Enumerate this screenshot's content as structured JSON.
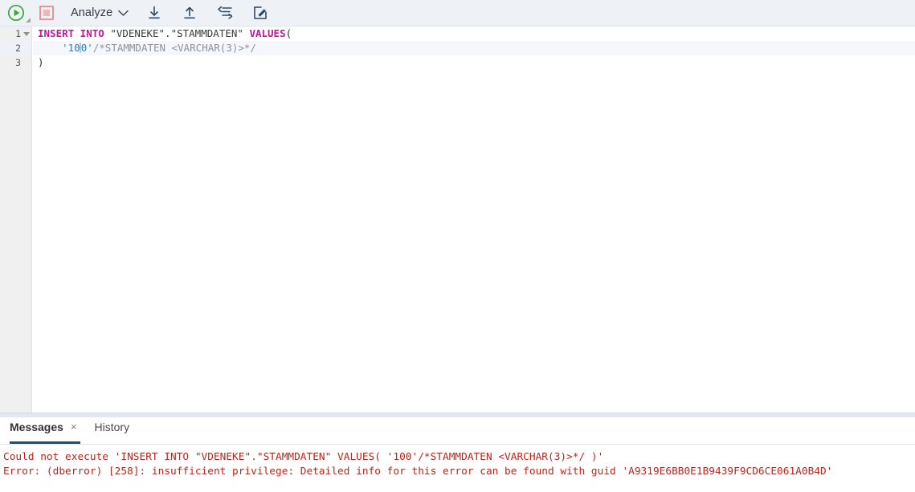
{
  "toolbar": {
    "run_button": "run-query",
    "run_dropdown": "run-options",
    "stop_button": "stop-query",
    "analyze_label": "Analyze",
    "analyze_caret": "chevron-down",
    "download_label": "download-sql",
    "upload_label": "upload-sql",
    "format_label": "format-sql",
    "edit_label": "edit-sql",
    "icons": {
      "run": "play-circle-icon",
      "stop": "stop-square-icon",
      "download": "arrow-down-to-line-icon",
      "upload": "arrow-up-from-line-icon",
      "format": "format-indent-icon",
      "edit": "pencil-square-icon"
    },
    "colors": {
      "background": "#eef1f6",
      "run_green": "#3aa83a",
      "stop_red": "#e98b8b",
      "icon_dark": "#2f4a66"
    }
  },
  "editor": {
    "lines": [
      {
        "number": "1",
        "folded": false,
        "has_fold_marker": true,
        "active": false,
        "tokens": [
          {
            "t": "INSERT INTO",
            "c": "kw"
          },
          {
            "t": " ",
            "c": "plain"
          },
          {
            "t": "\"VDENEKE\".\"STAMMDATEN\"",
            "c": "ident"
          },
          {
            "t": " ",
            "c": "plain"
          },
          {
            "t": "VALUES",
            "c": "kw"
          },
          {
            "t": "(",
            "c": "plain"
          }
        ]
      },
      {
        "number": "2",
        "has_fold_marker": false,
        "active": true,
        "tokens": [
          {
            "t": "    ",
            "c": "plain"
          },
          {
            "t": "'10",
            "c": "str"
          },
          {
            "t": "CARET",
            "c": "caret"
          },
          {
            "t": "0'",
            "c": "str"
          },
          {
            "t": "/*STAMMDATEN <VARCHAR(3)>*/",
            "c": "cmt"
          }
        ]
      },
      {
        "number": "3",
        "has_fold_marker": false,
        "active": false,
        "tokens": [
          {
            "t": ")",
            "c": "plain"
          }
        ]
      }
    ],
    "colors": {
      "keyword": "#c5169c",
      "identifier": "#3b3b3b",
      "string": "#2b7fb8",
      "comment": "#8d9299",
      "gutter_bg": "#f0f0f0",
      "active_line_bg": "#f5f7fc"
    }
  },
  "bottom_panel": {
    "tabs": [
      {
        "label": "Messages",
        "active": true,
        "closable": true,
        "close_glyph": "×"
      },
      {
        "label": "History",
        "active": false,
        "closable": false,
        "close_glyph": ""
      }
    ],
    "messages": [
      "Could not execute 'INSERT INTO \"VDENEKE\".\"STAMMDATEN\" VALUES( '100'/*STAMMDATEN <VARCHAR(3)>*/ )'",
      "Error: (dberror) [258]: insufficient privilege: Detailed info for this error can be found with guid 'A9319E6BB0E1B9439F9CD6CE061A0B4D'"
    ],
    "message_color": "#c0241b"
  }
}
